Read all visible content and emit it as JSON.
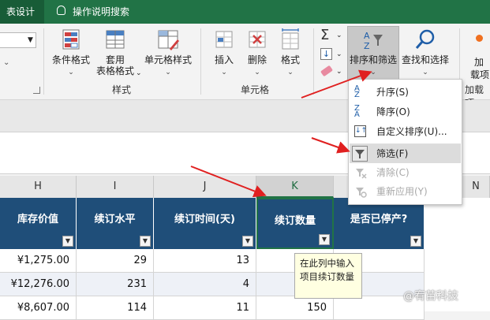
{
  "titlebar": {
    "tab": "表设计",
    "help": "操作说明搜索"
  },
  "ribbon": {
    "conditional_format": "条件格式",
    "table_format_line1": "套用",
    "table_format_line2": "表格格式",
    "cell_styles": "单元格样式",
    "group_styles": "样式",
    "insert": "插入",
    "delete": "删除",
    "format": "格式",
    "group_cells": "单元格",
    "sort_filter": "排序和筛选",
    "find_select": "查找和选择",
    "addins_line1": "加",
    "addins_line2": "载项",
    "group_addins": "加载项"
  },
  "menu": {
    "items": [
      {
        "label": "升序(S)",
        "icon": "sort-ascending-icon"
      },
      {
        "label": "降序(O)",
        "icon": "sort-descending-icon"
      },
      {
        "label": "自定义排序(U)...",
        "icon": "custom-sort-icon"
      },
      {
        "label": "筛选(F)",
        "icon": "filter-icon"
      },
      {
        "label": "清除(C)",
        "icon": "clear-filter-icon"
      },
      {
        "label": "重新应用(Y)",
        "icon": "reapply-icon"
      }
    ]
  },
  "columns": [
    "H",
    "I",
    "J",
    "K",
    "N"
  ],
  "headers": [
    "库存价值",
    "续订水平",
    "续订时间(天)",
    "续订数量",
    "是否已停产?"
  ],
  "rows": [
    [
      "¥1,275.00",
      "29",
      "13",
      ""
    ],
    [
      "¥12,276.00",
      "231",
      "4",
      ""
    ],
    [
      "¥8,607.00",
      "114",
      "11",
      "150"
    ]
  ],
  "tooltip": {
    "line1": "在此列中输入",
    "line2": "项目续订数量"
  },
  "watermark": "@宥苗科技",
  "colors": {
    "title_green": "#217346",
    "header_blue": "#1f4e79",
    "arrow_red": "#e02020"
  }
}
